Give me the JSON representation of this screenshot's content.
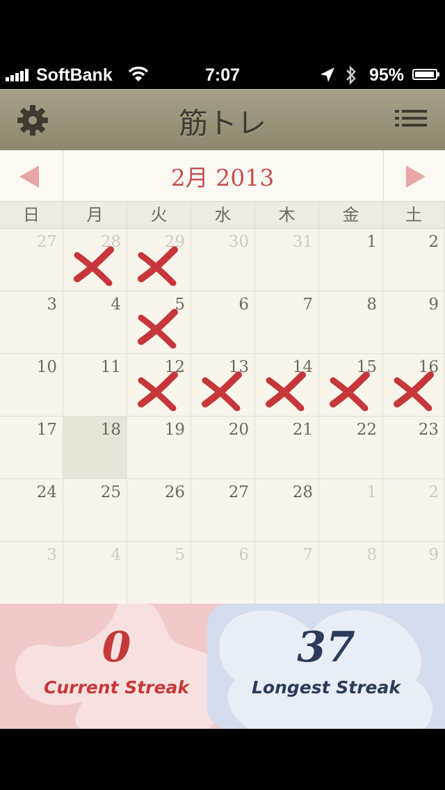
{
  "status_bar": {
    "carrier": "SoftBank",
    "time": "7:07",
    "battery_percent": "95%",
    "battery_level": 0.95,
    "icons": [
      "signal-icon",
      "wifi-icon",
      "location-icon",
      "bluetooth-icon",
      "battery-icon"
    ]
  },
  "nav": {
    "title": "筋トレ",
    "left_icon": "gear-icon",
    "right_icon": "list-icon"
  },
  "calendar": {
    "month_label": "2月 2013",
    "weekdays": [
      "日",
      "月",
      "火",
      "水",
      "木",
      "金",
      "土"
    ],
    "weeks": [
      [
        {
          "d": "27",
          "m": "other"
        },
        {
          "d": "28",
          "m": "other",
          "x": true
        },
        {
          "d": "29",
          "m": "other",
          "x": true
        },
        {
          "d": "30",
          "m": "other"
        },
        {
          "d": "31",
          "m": "other"
        },
        {
          "d": "1"
        },
        {
          "d": "2"
        }
      ],
      [
        {
          "d": "3"
        },
        {
          "d": "4"
        },
        {
          "d": "5",
          "x": true
        },
        {
          "d": "6"
        },
        {
          "d": "7"
        },
        {
          "d": "8"
        },
        {
          "d": "9"
        }
      ],
      [
        {
          "d": "10"
        },
        {
          "d": "11"
        },
        {
          "d": "12",
          "x": true
        },
        {
          "d": "13",
          "x": true
        },
        {
          "d": "14",
          "x": true
        },
        {
          "d": "15",
          "x": true
        },
        {
          "d": "16",
          "x": true
        }
      ],
      [
        {
          "d": "17"
        },
        {
          "d": "18",
          "today": true
        },
        {
          "d": "19"
        },
        {
          "d": "20"
        },
        {
          "d": "21"
        },
        {
          "d": "22"
        },
        {
          "d": "23"
        }
      ],
      [
        {
          "d": "24"
        },
        {
          "d": "25"
        },
        {
          "d": "26"
        },
        {
          "d": "27"
        },
        {
          "d": "28"
        },
        {
          "d": "1",
          "m": "other"
        },
        {
          "d": "2",
          "m": "other"
        }
      ],
      [
        {
          "d": "3",
          "m": "other"
        },
        {
          "d": "4",
          "m": "other"
        },
        {
          "d": "5",
          "m": "other"
        },
        {
          "d": "6",
          "m": "other"
        },
        {
          "d": "7",
          "m": "other"
        },
        {
          "d": "8",
          "m": "other"
        },
        {
          "d": "9",
          "m": "other"
        }
      ]
    ]
  },
  "streaks": {
    "current_value": "0",
    "current_label": "Current Streak",
    "longest_value": "37",
    "longest_label": "Longest Streak"
  },
  "colors": {
    "accent_red": "#c94d4d",
    "mark_red": "#c7373a",
    "navbar": "#9a9480",
    "current_bg": "#f0c9c8",
    "longest_bg": "#d3dcec"
  }
}
